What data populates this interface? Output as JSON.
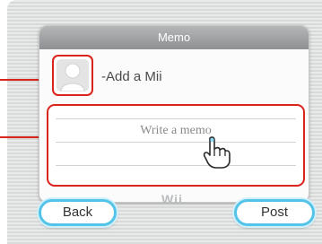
{
  "window": {
    "title": "Memo"
  },
  "mii": {
    "label": "Add a Mii"
  },
  "memo": {
    "placeholder": "Write a memo"
  },
  "footer": {
    "logo": "Wii"
  },
  "buttons": {
    "back_label": "Back",
    "post_label": "Post"
  },
  "colors": {
    "highlight": "#d9231b",
    "button_border": "#54c3e8",
    "header_bg": "#8e9093"
  },
  "icons": {
    "mii_placeholder": "person-silhouette-icon",
    "cursor": "hand-pointer-icon"
  }
}
